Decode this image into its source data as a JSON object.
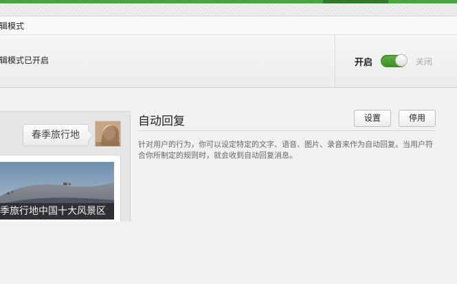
{
  "panel": {
    "title": "编辑模式",
    "status_text": "编辑模式已开启",
    "toggle": {
      "on_label": "开启",
      "off_label": "关闭",
      "state": "on",
      "color": "#4c9f2f"
    }
  },
  "preview": {
    "bubble_text": "春季旅行地",
    "card_caption": "春季旅行地中国十大风景区"
  },
  "auto_reply": {
    "title": "自动回复",
    "settings_button": "设置",
    "disable_button": "停用",
    "description": "针对用户的行为，你可以设定特定的文字、语音、图片、录音来作为自动回复。当用户符合你所制定的规则时，就会收到自动回复消息。"
  },
  "colors": {
    "accent_green": "#44a73a",
    "accent_dark": "#2f7a2a"
  }
}
